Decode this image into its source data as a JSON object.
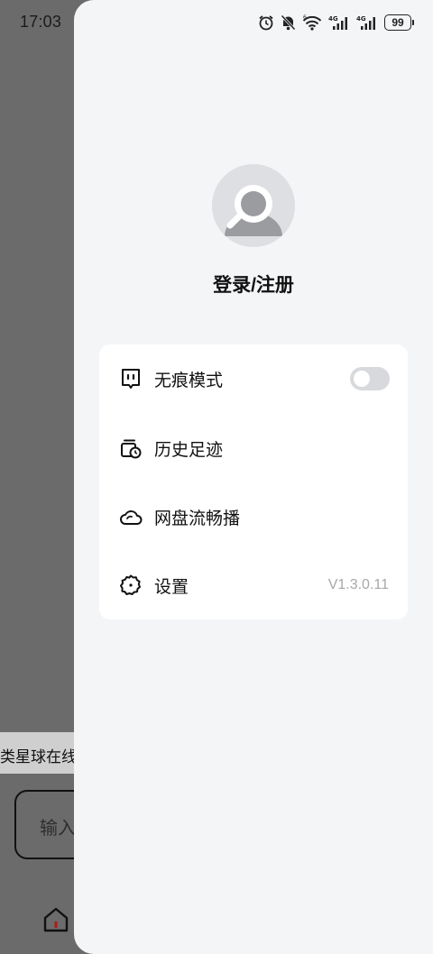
{
  "status_bar": {
    "time": "17:03",
    "battery": "99",
    "icons": [
      "alarm-icon",
      "mute-bell-icon",
      "wifi-icon",
      "signal-4g-icon",
      "signal-4g-icon",
      "battery-icon"
    ]
  },
  "background": {
    "banner_text": "类星球在线观",
    "input_placeholder": "输入",
    "nav_icon": "home-icon"
  },
  "drawer": {
    "login_label": "登录/注册",
    "menu": {
      "incognito": {
        "label": "无痕模式",
        "icon": "incognito-face-icon",
        "toggle_on": false
      },
      "history": {
        "label": "历史足迹",
        "icon": "history-clock-icon"
      },
      "cloud": {
        "label": "网盘流畅播",
        "icon": "cloud-icon"
      },
      "settings": {
        "label": "设置",
        "icon": "gear-icon",
        "version": "V1.3.0.11"
      }
    }
  },
  "colors": {
    "overlay": "#6b6b6b",
    "drawer_bg": "#f4f5f7",
    "card_bg": "#ffffff",
    "avatar_bg": "#dedfe2",
    "version_text": "#a7a8ab"
  }
}
